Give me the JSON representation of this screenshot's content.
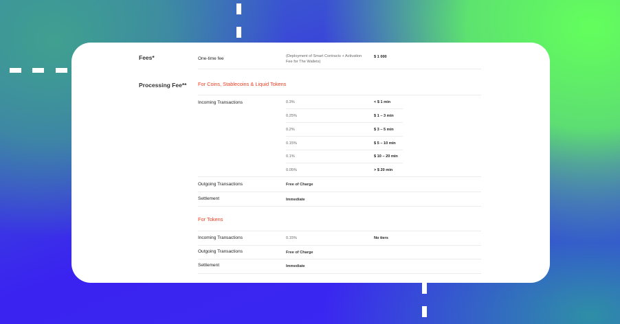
{
  "colors": {
    "accent": "#ee3b1e",
    "green": "#63ff5c",
    "blue": "#3a22f0"
  },
  "fees": {
    "title": "Fees*",
    "one_time_label": "One-time fee",
    "one_time_desc_line1": "(Deployment of Smart Contracts + Activation",
    "one_time_desc_line2": "Fee for The Wallets)",
    "one_time_amount": "$ 1 000"
  },
  "processing": {
    "title": "Processing Fee**",
    "coins": {
      "heading": "For Coins,  Stablecoins & Liquid Tokens",
      "incoming_label": "Incoming Transactions",
      "tiers": [
        {
          "rate": "0.3%",
          "range": "< $ 1 min"
        },
        {
          "rate": "0.25%",
          "range": "$ 1 – 3 min"
        },
        {
          "rate": "0.2%",
          "range": "$ 3 – 5 min"
        },
        {
          "rate": "0.15%",
          "range": "$ 5 – 10 min"
        },
        {
          "rate": "0.1%",
          "range": "$ 10 – 20 min"
        },
        {
          "rate": "0.05%",
          "range": "> $ 20 min"
        }
      ],
      "outgoing_label": "Outgoing Transactions",
      "outgoing_value": "Free of Charge",
      "settlement_label": "Settlement",
      "settlement_value": "Immediate"
    },
    "tokens": {
      "heading": "For Tokens",
      "incoming_label": "Incoming Transactions",
      "incoming_rate": "0.15%",
      "incoming_note": "No tiers",
      "outgoing_label": "Outgoing Transactions",
      "outgoing_value": "Free of Charge",
      "settlement_label": "Settlement",
      "settlement_value": "Immediate"
    }
  }
}
